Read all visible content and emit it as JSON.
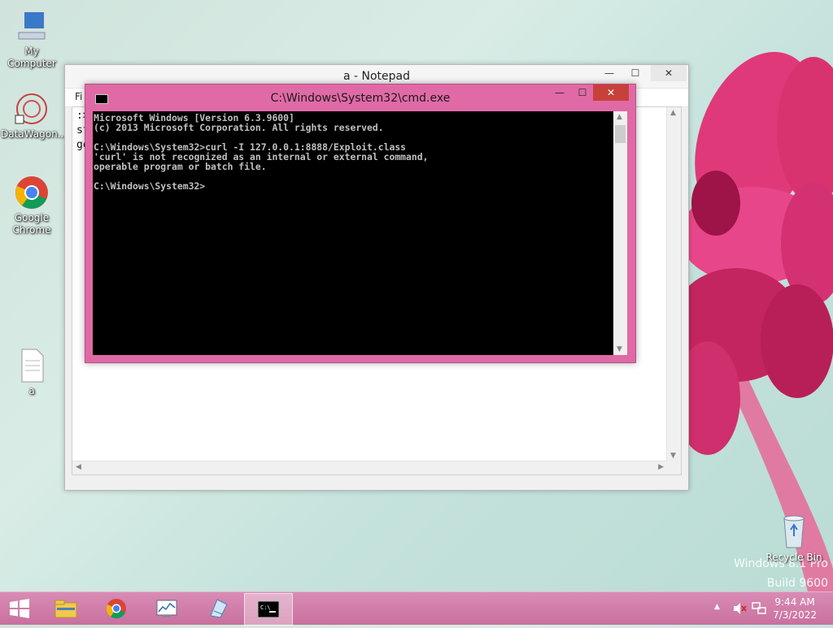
{
  "desktop": {
    "icons": [
      {
        "label": "My Computer"
      },
      {
        "label": "DataWagon..."
      },
      {
        "label": "Google Chrome"
      },
      {
        "label": "a"
      }
    ],
    "recycle_bin": {
      "label": "Recycle Bin"
    },
    "watermark": {
      "line1": "Windows 8.1 Pro",
      "line2": "Build 9600"
    }
  },
  "notepad": {
    "title": "a - Notepad",
    "menu_first": "Fi",
    "text_lines": [
      ":>",
      "st",
      "go"
    ],
    "buttons": {
      "minimize": "—",
      "maximize": "☐",
      "close": "✕"
    }
  },
  "cmd": {
    "title": "C:\\Windows\\System32\\cmd.exe",
    "lines": [
      "Microsoft Windows [Version 6.3.9600]",
      "(c) 2013 Microsoft Corporation. All rights reserved.",
      "",
      "C:\\Windows\\System32>curl -I 127.0.0.1:8888/Exploit.class",
      "'curl' is not recognized as an internal or external command,",
      "operable program or batch file.",
      "",
      "C:\\Windows\\System32>"
    ],
    "buttons": {
      "minimize": "—",
      "maximize": "☐",
      "close": "✕"
    }
  },
  "taskbar": {
    "clock_time": "9:44 AM",
    "clock_date": "7/3/2022",
    "apps": [
      "file-explorer",
      "google-chrome",
      "performance-monitor",
      "notepad",
      "command-prompt"
    ]
  },
  "colors": {
    "cmd_frame": "#e06aa6",
    "taskbar": "#d07ba9",
    "close_red": "#c7403a"
  }
}
